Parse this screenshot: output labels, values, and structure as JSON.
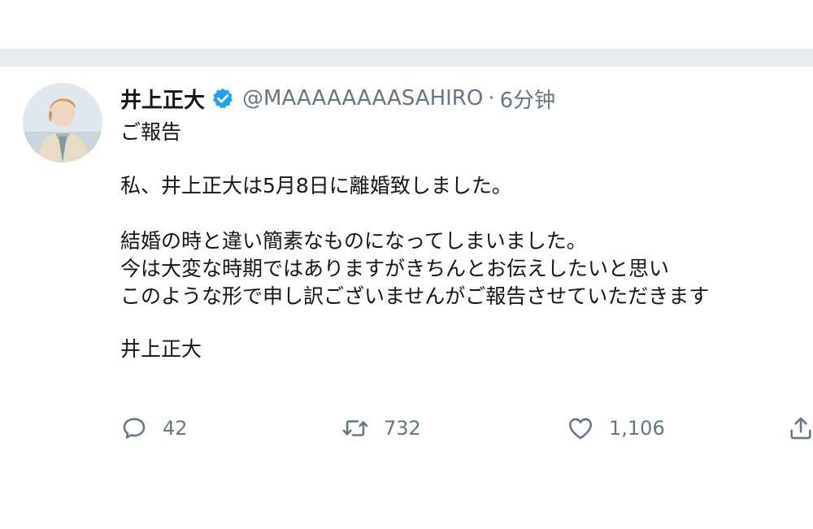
{
  "tweet": {
    "display_name": "井上正大",
    "handle": "@MAAAAAAAASAHIRO",
    "separator": "·",
    "time": "6分钟",
    "lines": [
      "ご報告",
      "私、井上正大は5月8日に離婚致しました。",
      "結婚の時と違い簡素なものになってしまいました。",
      "今は大変な時期ではありますがきちんとお伝えしたいと思い",
      "このような形で申し訳ございませんがご報告させていただきます",
      "井上正大"
    ],
    "counts": {
      "replies": "42",
      "retweets": "732",
      "likes": "1,106"
    }
  },
  "icons": {
    "verified": "verified-badge-icon",
    "reply": "reply-icon",
    "retweet": "retweet-icon",
    "like": "heart-icon",
    "share": "share-icon"
  },
  "colors": {
    "divider": "#e6ecf0",
    "verified": "#1da1f2",
    "muted": "#657786",
    "text": "#14171a"
  }
}
